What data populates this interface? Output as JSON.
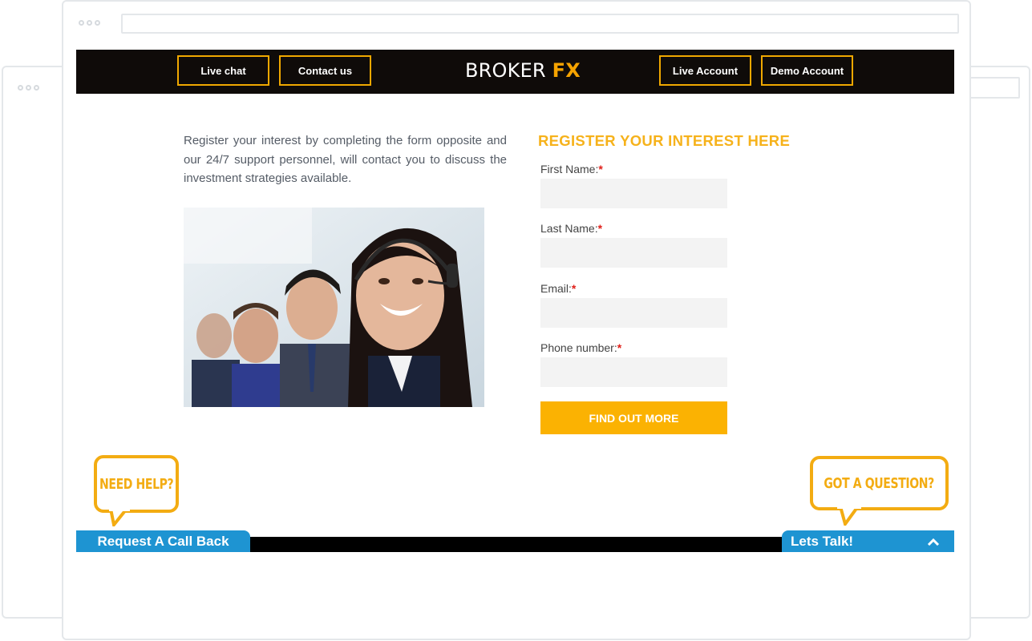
{
  "header": {
    "nav_left": [
      "Live chat",
      "Contact us"
    ],
    "logo_main": "BROKER",
    "logo_accent": "FX",
    "nav_right": [
      "Live Account",
      "Demo Account"
    ]
  },
  "intro": {
    "text": "Register your interest by completing the form opposite and our 24/7 support personnel, will contact you to discuss the investment strategies available."
  },
  "form": {
    "title": "REGISTER YOUR INTEREST HERE",
    "fields": [
      {
        "label": "First Name:",
        "required_mark": "*",
        "value": ""
      },
      {
        "label": "Last Name:",
        "required_mark": "*",
        "value": ""
      },
      {
        "label": "Email:",
        "required_mark": "*",
        "value": ""
      },
      {
        "label": "Phone number:",
        "required_mark": "*",
        "value": ""
      }
    ],
    "submit_label": "FIND OUT MORE"
  },
  "widgets": {
    "need_help": "NEED HELP?",
    "got_question": "GOT A QUESTION?",
    "request_callback": "Request A Call Back",
    "lets_talk": "Lets Talk!"
  },
  "colors": {
    "accent": "#f6b21b",
    "header_bg": "#0f0b09",
    "tab_blue": "#1e94d2"
  }
}
